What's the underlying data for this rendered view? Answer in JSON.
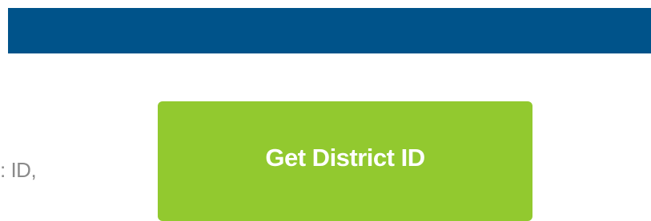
{
  "header": {
    "color": "#00538a"
  },
  "content": {
    "partial_text": ": ID,"
  },
  "cta": {
    "label": "Get District ID",
    "color": "#92c92f"
  }
}
